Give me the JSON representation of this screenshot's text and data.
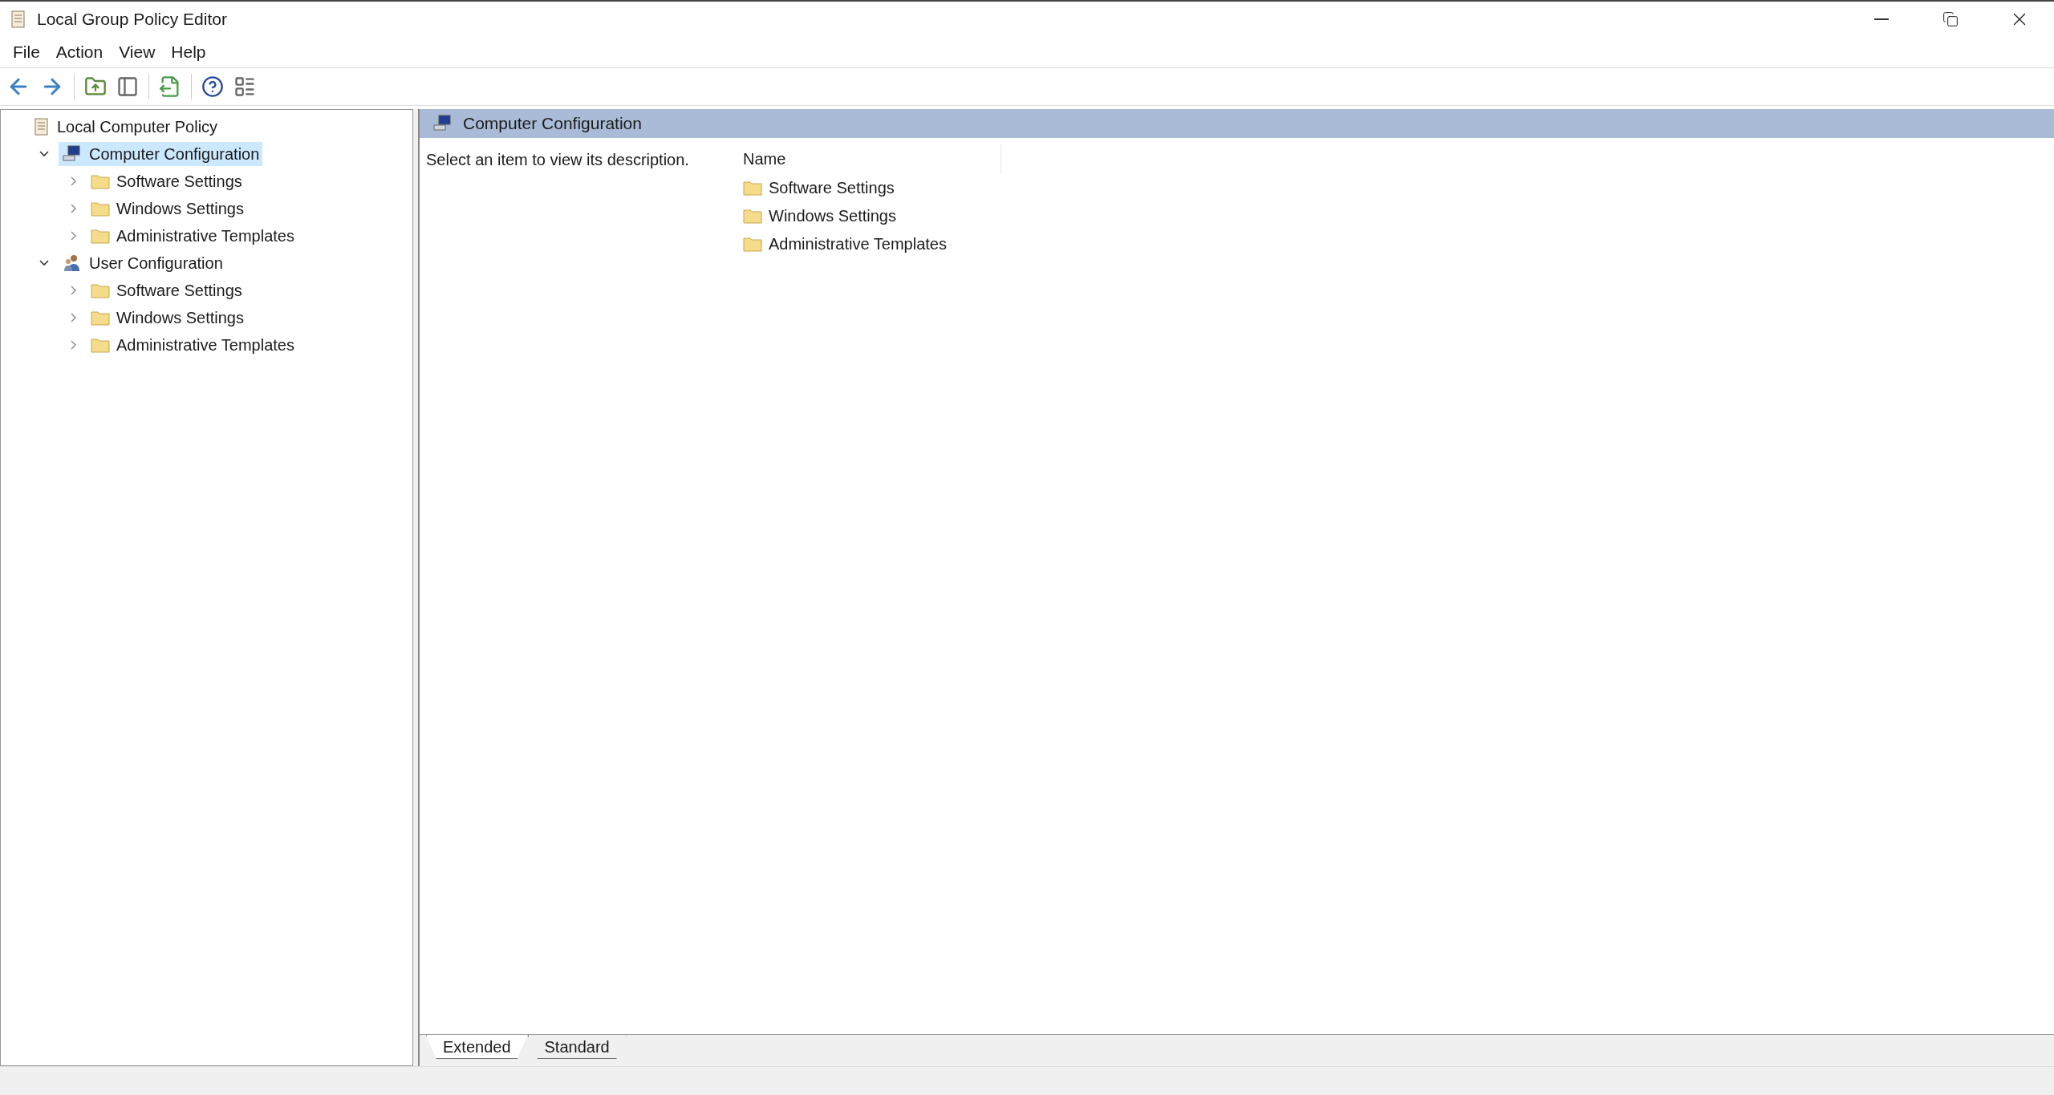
{
  "window": {
    "title": "Local Group Policy Editor"
  },
  "menu": [
    "File",
    "Action",
    "View",
    "Help"
  ],
  "tree": [
    {
      "label": "Local Computer Policy",
      "kind": "policy",
      "selected": false,
      "children": [
        {
          "label": "Computer Configuration",
          "kind": "computer",
          "selected": true,
          "expanded": true,
          "children": [
            {
              "label": "Software Settings",
              "kind": "folder",
              "selected": false,
              "expanded": false
            },
            {
              "label": "Windows Settings",
              "kind": "folder",
              "selected": false,
              "expanded": false
            },
            {
              "label": "Administrative Templates",
              "kind": "folder",
              "selected": false,
              "expanded": false
            }
          ]
        },
        {
          "label": "User Configuration",
          "kind": "user",
          "selected": false,
          "expanded": true,
          "children": [
            {
              "label": "Software Settings",
              "kind": "folder",
              "selected": false,
              "expanded": false
            },
            {
              "label": "Windows Settings",
              "kind": "folder",
              "selected": false,
              "expanded": false
            },
            {
              "label": "Administrative Templates",
              "kind": "folder",
              "selected": false,
              "expanded": false
            }
          ]
        }
      ]
    }
  ],
  "details": {
    "header": "Computer Configuration",
    "description": "Select an item to view its description.",
    "columns": [
      "Name"
    ],
    "items": [
      {
        "label": "Software Settings"
      },
      {
        "label": "Windows Settings"
      },
      {
        "label": "Administrative Templates"
      }
    ]
  },
  "view_tabs": [
    {
      "label": "Extended",
      "selected": true
    },
    {
      "label": "Standard",
      "selected": false
    }
  ]
}
